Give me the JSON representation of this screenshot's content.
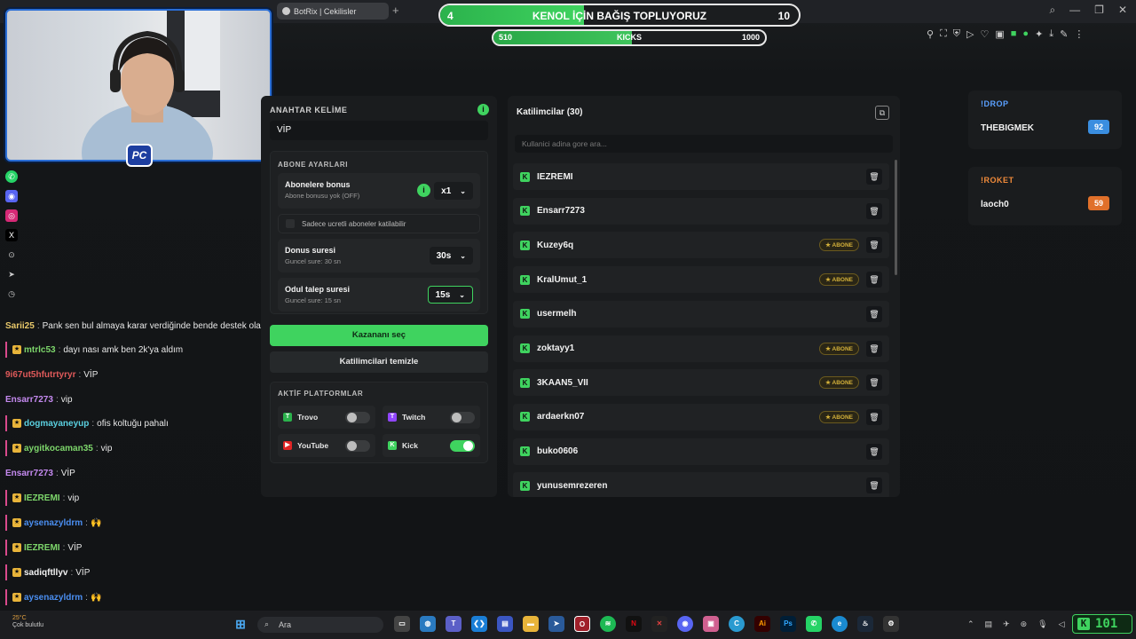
{
  "browser": {
    "tab_title": "BotRix | Cekilisler",
    "new_tab": "+",
    "window_controls": [
      "⌕",
      "—",
      "❐",
      "✕"
    ]
  },
  "donation": {
    "left": "4",
    "title": "KENOL İÇİN BAĞIŞ TOPLUYORUZ",
    "right": "10",
    "progress": 0.4
  },
  "kicks": {
    "left": "510",
    "title": "KICKS",
    "right": "1000",
    "progress": 0.51
  },
  "webcam": {
    "logo": "PC"
  },
  "chat": [
    {
      "user": "Sarii25",
      "msg": "Pank sen bul almaya karar verdiğinde bende destek olayım",
      "color": "#e8c86a",
      "sub": false
    },
    {
      "user": "mtrlc53",
      "msg": "dayı nası amk ben 2k'ya aldım",
      "color": "#7dd66b",
      "sub": true
    },
    {
      "user": "9i67ut5hfutrtyryr",
      "msg": "VİP",
      "color": "#e05a5a",
      "sub": false
    },
    {
      "user": "Ensarr7273",
      "msg": "vip",
      "color": "#c58af0",
      "sub": false
    },
    {
      "user": "dogmayaneyup",
      "msg": "ofis koltuğu pahalı",
      "color": "#5ad0e0",
      "sub": true
    },
    {
      "user": "aygitkocaman35",
      "msg": "vip",
      "color": "#7dd66b",
      "sub": true
    },
    {
      "user": "Ensarr7273",
      "msg": "VİP",
      "color": "#c58af0",
      "sub": false
    },
    {
      "user": "IEZREMI",
      "msg": "vip",
      "color": "#7dd66b",
      "sub": true
    },
    {
      "user": "aysenazyldrm",
      "msg": "🙌",
      "color": "#4a8ef0",
      "sub": true
    },
    {
      "user": "IEZREMI",
      "msg": "VİP",
      "color": "#7dd66b",
      "sub": true
    },
    {
      "user": "sadiqftllyv",
      "msg": "VİP",
      "color": "#f2f2f2",
      "sub": true
    },
    {
      "user": "aysenazyldrm",
      "msg": "🙌",
      "color": "#4a8ef0",
      "sub": true
    }
  ],
  "settings": {
    "keyword_label": "ANAHTAR KELİME",
    "keyword_value": "VİP",
    "sub_section": "ABONE AYARLARI",
    "sub_bonus_title": "Abonelere bonus",
    "sub_bonus_sub": "Abone bonusu yok (OFF)",
    "sub_bonus_value": "x1",
    "paid_only_label": "Sadece ucretli aboneler katilabilir",
    "bonus_time_title": "Donus suresi",
    "bonus_time_sub": "Guncel sure: 30 sn",
    "bonus_time_value": "30s",
    "claim_time_title": "Odul talep suresi",
    "claim_time_sub": "Guncel sure: 15 sn",
    "claim_time_value": "15s",
    "pick_winner": "Kazananı seç",
    "clear_participants": "Katilimcilari temizle",
    "platforms_section": "AKTİF PLATFORMLAR",
    "platforms": [
      {
        "name": "Trovo",
        "on": false,
        "color": "#2bb24c",
        "glyph": "T"
      },
      {
        "name": "Twitch",
        "on": false,
        "color": "#9146ff",
        "glyph": "T"
      },
      {
        "name": "YouTube",
        "on": false,
        "color": "#e02424",
        "glyph": "▶"
      },
      {
        "name": "Kick",
        "on": true,
        "color": "#3fd35f",
        "glyph": "K"
      }
    ]
  },
  "participants": {
    "title": "Katilimcilar (30)",
    "search_placeholder": "Kullanici adina gore ara...",
    "abone_label": "★ ABONE",
    "list": [
      {
        "name": "IEZREMI",
        "abone": false
      },
      {
        "name": "Ensarr7273",
        "abone": false
      },
      {
        "name": "Kuzey6q",
        "abone": true
      },
      {
        "name": "KralUmut_1",
        "abone": true
      },
      {
        "name": "usermelh",
        "abone": false
      },
      {
        "name": "zoktayy1",
        "abone": true
      },
      {
        "name": "3KAAN5_VII",
        "abone": true
      },
      {
        "name": "ardaerkn07",
        "abone": true
      },
      {
        "name": "buko0606",
        "abone": false
      },
      {
        "name": "yunusemrezeren",
        "abone": false
      }
    ]
  },
  "widgets": [
    {
      "title": "!DROP",
      "name": "THEBIGMEK",
      "value": "92",
      "title_color": "#5aa0ff",
      "value_color": "#3a8ee0"
    },
    {
      "title": "!ROKET",
      "name": "laoch0",
      "value": "59",
      "title_color": "#f08a3a",
      "value_color": "#e0702a"
    }
  ],
  "taskbar": {
    "search": "Ara",
    "weather_temp": "25°C",
    "weather_text": "Çok bulutlu",
    "kick_count": "101"
  }
}
